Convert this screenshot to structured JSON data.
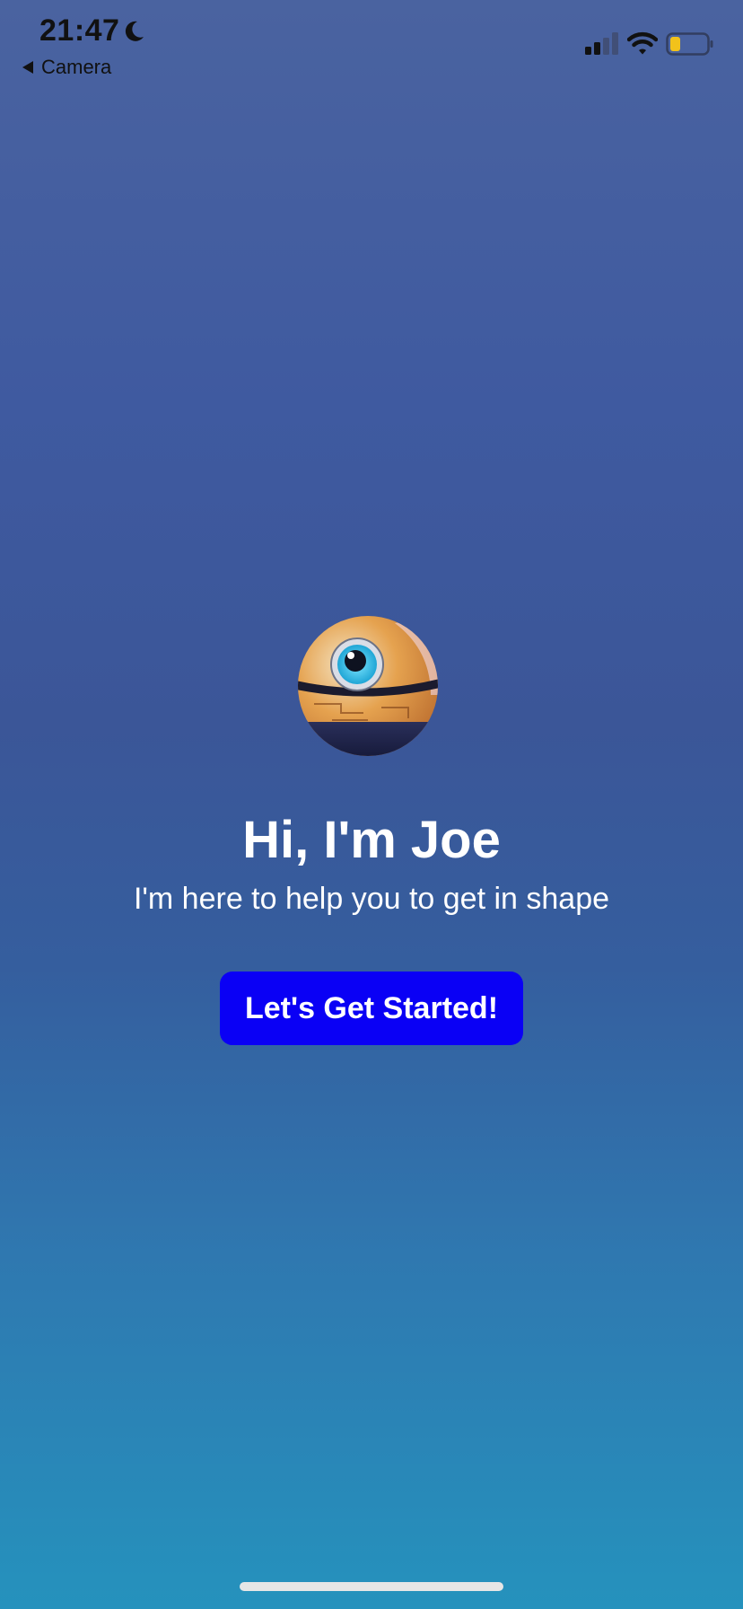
{
  "status_bar": {
    "time": "21:47",
    "back_label": "Camera",
    "icons": [
      "moon-icon",
      "back-arrow-icon",
      "cellular-signal-icon",
      "wifi-icon",
      "battery-icon"
    ]
  },
  "welcome": {
    "mascot_icon": "robot-eyeball-mascot",
    "headline": "Hi, I'm Joe",
    "subtitle": "I'm here to help you to get in shape",
    "cta_label": "Let's Get Started!"
  },
  "colors": {
    "background_top": "#4a63a0",
    "background_bottom": "#2592bd",
    "cta_background": "#0a00f5",
    "text": "#ffffff",
    "battery_fill": "#f2c21b"
  }
}
